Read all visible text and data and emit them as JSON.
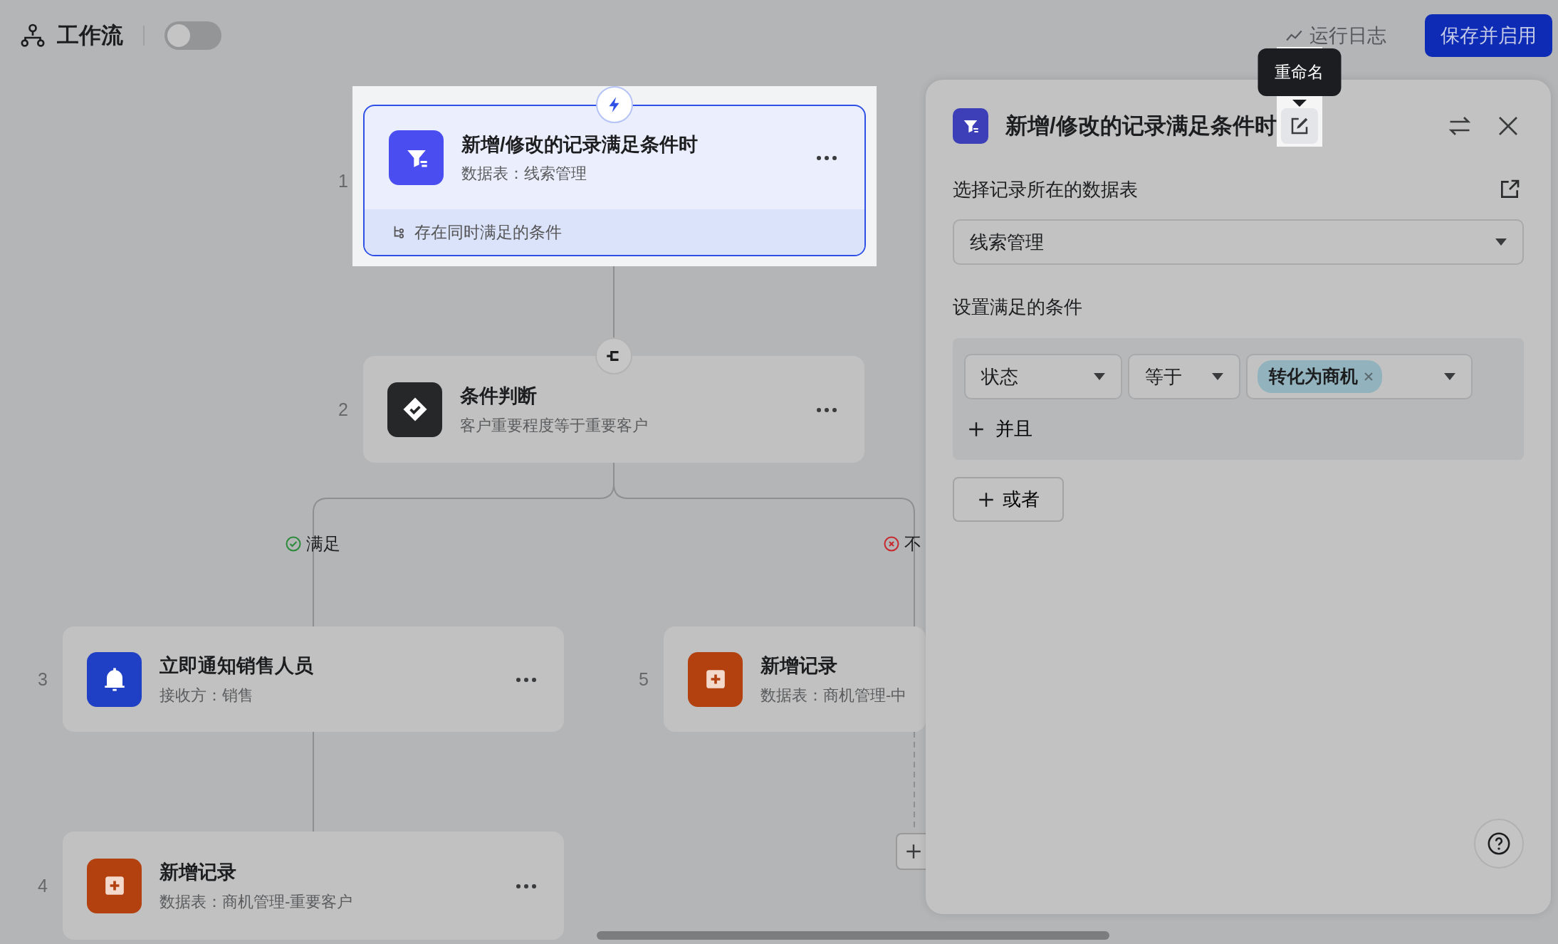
{
  "header": {
    "title": "工作流",
    "toggle_on": false,
    "run_log": "运行日志",
    "save_button": "保存并启用"
  },
  "nodes": [
    {
      "number": "1",
      "kind": "trigger",
      "title": "新增/修改的记录满足条件时",
      "subtitle": "数据表：线索管理",
      "footer": "存在同时满足的条件",
      "selected": true
    },
    {
      "number": "2",
      "kind": "condition",
      "title": "条件判断",
      "subtitle": "客户重要程度等于重要客户",
      "selected": false
    },
    {
      "number": "3",
      "kind": "notify",
      "title": "立即通知销售人员",
      "subtitle": "接收方：销售",
      "selected": false
    },
    {
      "number": "5",
      "kind": "add",
      "title": "新增记录",
      "subtitle": "数据表：商机管理-中",
      "selected": false
    },
    {
      "number": "4",
      "kind": "add",
      "title": "新增记录",
      "subtitle": "数据表：商机管理-重要客户",
      "selected": false
    }
  ],
  "branches": [
    {
      "kind": "yes",
      "label": "满足"
    },
    {
      "kind": "no",
      "label": "不"
    }
  ],
  "panel": {
    "title": "新增/修改的记录满足条件时",
    "tooltip": "重命名",
    "table_label": "选择记录所在的数据表",
    "table_value": "线索管理",
    "conditions_label": "设置满足的条件",
    "conditions": [
      {
        "field": "状态",
        "operator": "等于",
        "values": [
          "转化为商机"
        ]
      }
    ],
    "and_button": "并且",
    "or_button": "或者"
  }
}
